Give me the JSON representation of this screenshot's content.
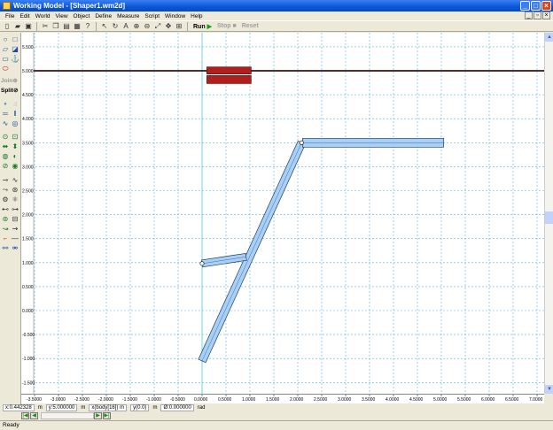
{
  "window": {
    "title": "Working Model - [Shaper1.wm2d]"
  },
  "menu": [
    "File",
    "Edit",
    "World",
    "View",
    "Object",
    "Define",
    "Measure",
    "Script",
    "Window",
    "Help"
  ],
  "toolbar": {
    "run": "Run",
    "stop": "Stop",
    "reset": "Reset"
  },
  "left_toolbar": {
    "join": "Join",
    "split": "Split"
  },
  "y_ruler": [
    "5.500",
    "5.000",
    "4.500",
    "4.000",
    "3.500",
    "3.000",
    "2.500",
    "2.000",
    "1.500",
    "1.000",
    "0.500",
    "0.000",
    "-0.500",
    "-1.000",
    "-1.500"
  ],
  "x_ruler": [
    "-3.5000",
    "-3.0000",
    "-2.5000",
    "-2.0000",
    "-1.5000",
    "-1.0000",
    "-0.5000",
    "0.0000",
    "0.5000",
    "1.0000",
    "1.5000",
    "2.0000",
    "2.5000",
    "3.0000",
    "3.5000",
    "4.0000",
    "4.5000",
    "5.0000",
    "5.5000",
    "6.0000",
    "6.5000",
    "7.0000"
  ],
  "coords": {
    "x": "x:0.442328",
    "x_unit": "m",
    "y": "y:5.000000",
    "y_unit": "m",
    "body": "x(body[16]) m",
    "body_val": "y(0.0)",
    "body_unit": "m",
    "angle": "Ø:0.000000",
    "angle_unit": "rad"
  },
  "status": "Ready",
  "colors": {
    "grid": "#5aaee8",
    "body_fill": "#a9cff5",
    "block_fill": "#b01e1e",
    "axis": "#6fd6ef"
  }
}
